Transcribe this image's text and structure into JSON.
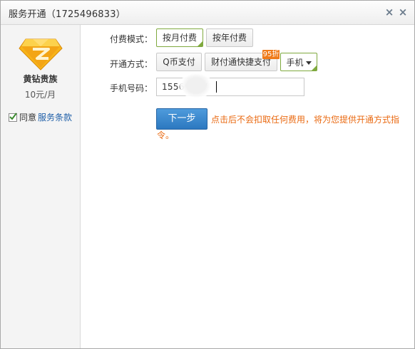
{
  "window": {
    "title": "服务开通（1725496833）",
    "minimize_glyph": "×",
    "close_glyph": "×"
  },
  "sidebar": {
    "product_icon": "yellow-diamond-icon",
    "product_name": "黄钻贵族",
    "price": "10元/月",
    "agree_label": "同意",
    "agree_checked": true,
    "terms_link": "服务条款"
  },
  "form": {
    "payment_mode": {
      "label": "付费模式：",
      "options": [
        "按月付费",
        "按年付费"
      ],
      "selected": "按月付费"
    },
    "payment_method": {
      "label": "开通方式：",
      "options": [
        "Q币支付",
        "财付通快捷支付",
        "手机"
      ],
      "selected": "手机",
      "discount_badge": "95折"
    },
    "phone": {
      "label": "手机号码：",
      "value": "1556****7"
    },
    "next_button": "下一步",
    "notice": "点击后不会扣取任何费用，将为您提供开通方式指令。"
  },
  "colors": {
    "accent_green": "#7fa93e",
    "primary_blue": "#2c78c0",
    "notice_orange": "#ea6a12",
    "badge_orange": "#ef7b1a",
    "link_blue": "#1f5fa8"
  }
}
